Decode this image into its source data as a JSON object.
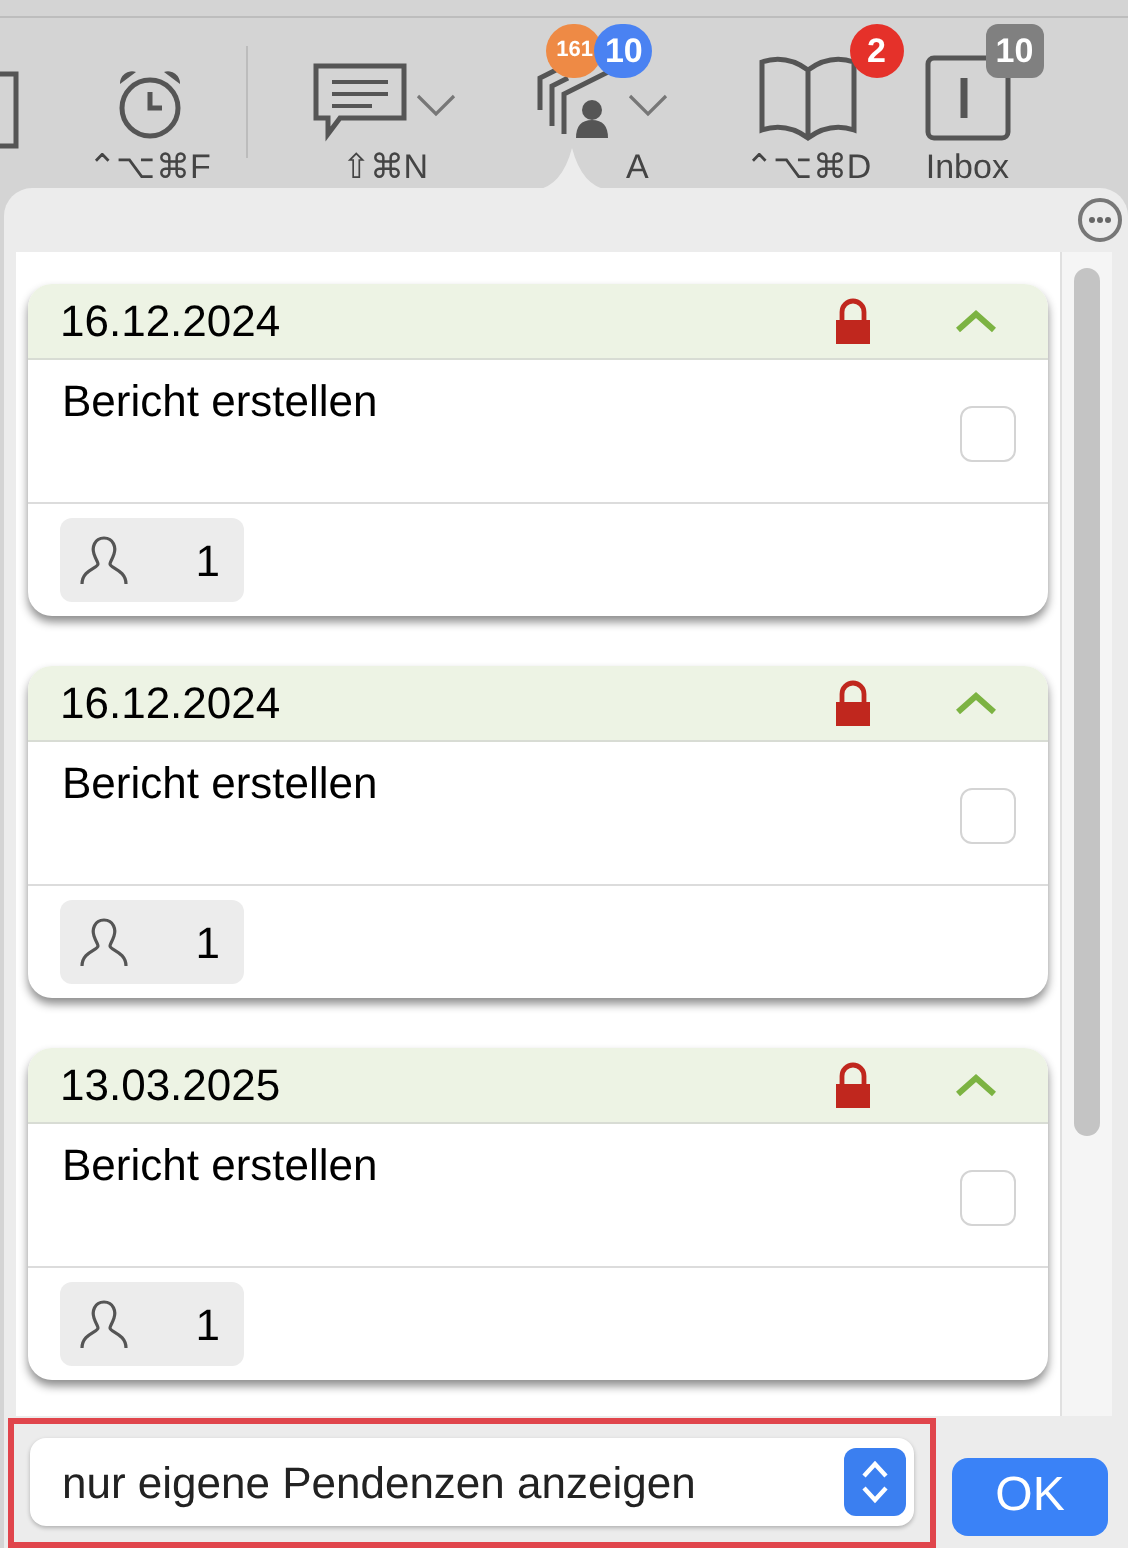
{
  "toolbar": {
    "items": [
      {
        "kind": "document"
      },
      {
        "kind": "alarm",
        "label": "⌃⌥⌘F",
        "menu": false
      },
      {
        "kind": "message",
        "label": "⇧⌘N",
        "menu": true
      },
      {
        "kind": "contacts",
        "label": "A",
        "badges": [
          {
            "text": "161",
            "color": "#ee8a45"
          },
          {
            "text": "10",
            "color": "#4a82f2"
          }
        ],
        "menu": true
      },
      {
        "kind": "book",
        "label": "⌃⌥⌘D",
        "badges": [
          {
            "text": "2",
            "color": "#e5312a"
          }
        ],
        "menu": false
      },
      {
        "kind": "inbox",
        "label": "Inbox",
        "badges": [
          {
            "text": "10",
            "color": "#808080"
          }
        ],
        "menu": false
      }
    ]
  },
  "tasks": [
    {
      "date": "16.12.2024",
      "locked": true,
      "expanded": true,
      "title": "Bericht erstellen",
      "checked": false,
      "participants": "1"
    },
    {
      "date": "16.12.2024",
      "locked": true,
      "expanded": true,
      "title": "Bericht erstellen",
      "checked": false,
      "participants": "1"
    },
    {
      "date": "13.03.2025",
      "locked": true,
      "expanded": true,
      "title": "Bericht erstellen",
      "checked": false,
      "participants": "1"
    }
  ],
  "filter": {
    "value": "nur eigene Pendenzen anzeigen"
  },
  "ok_button": {
    "label": "OK"
  }
}
